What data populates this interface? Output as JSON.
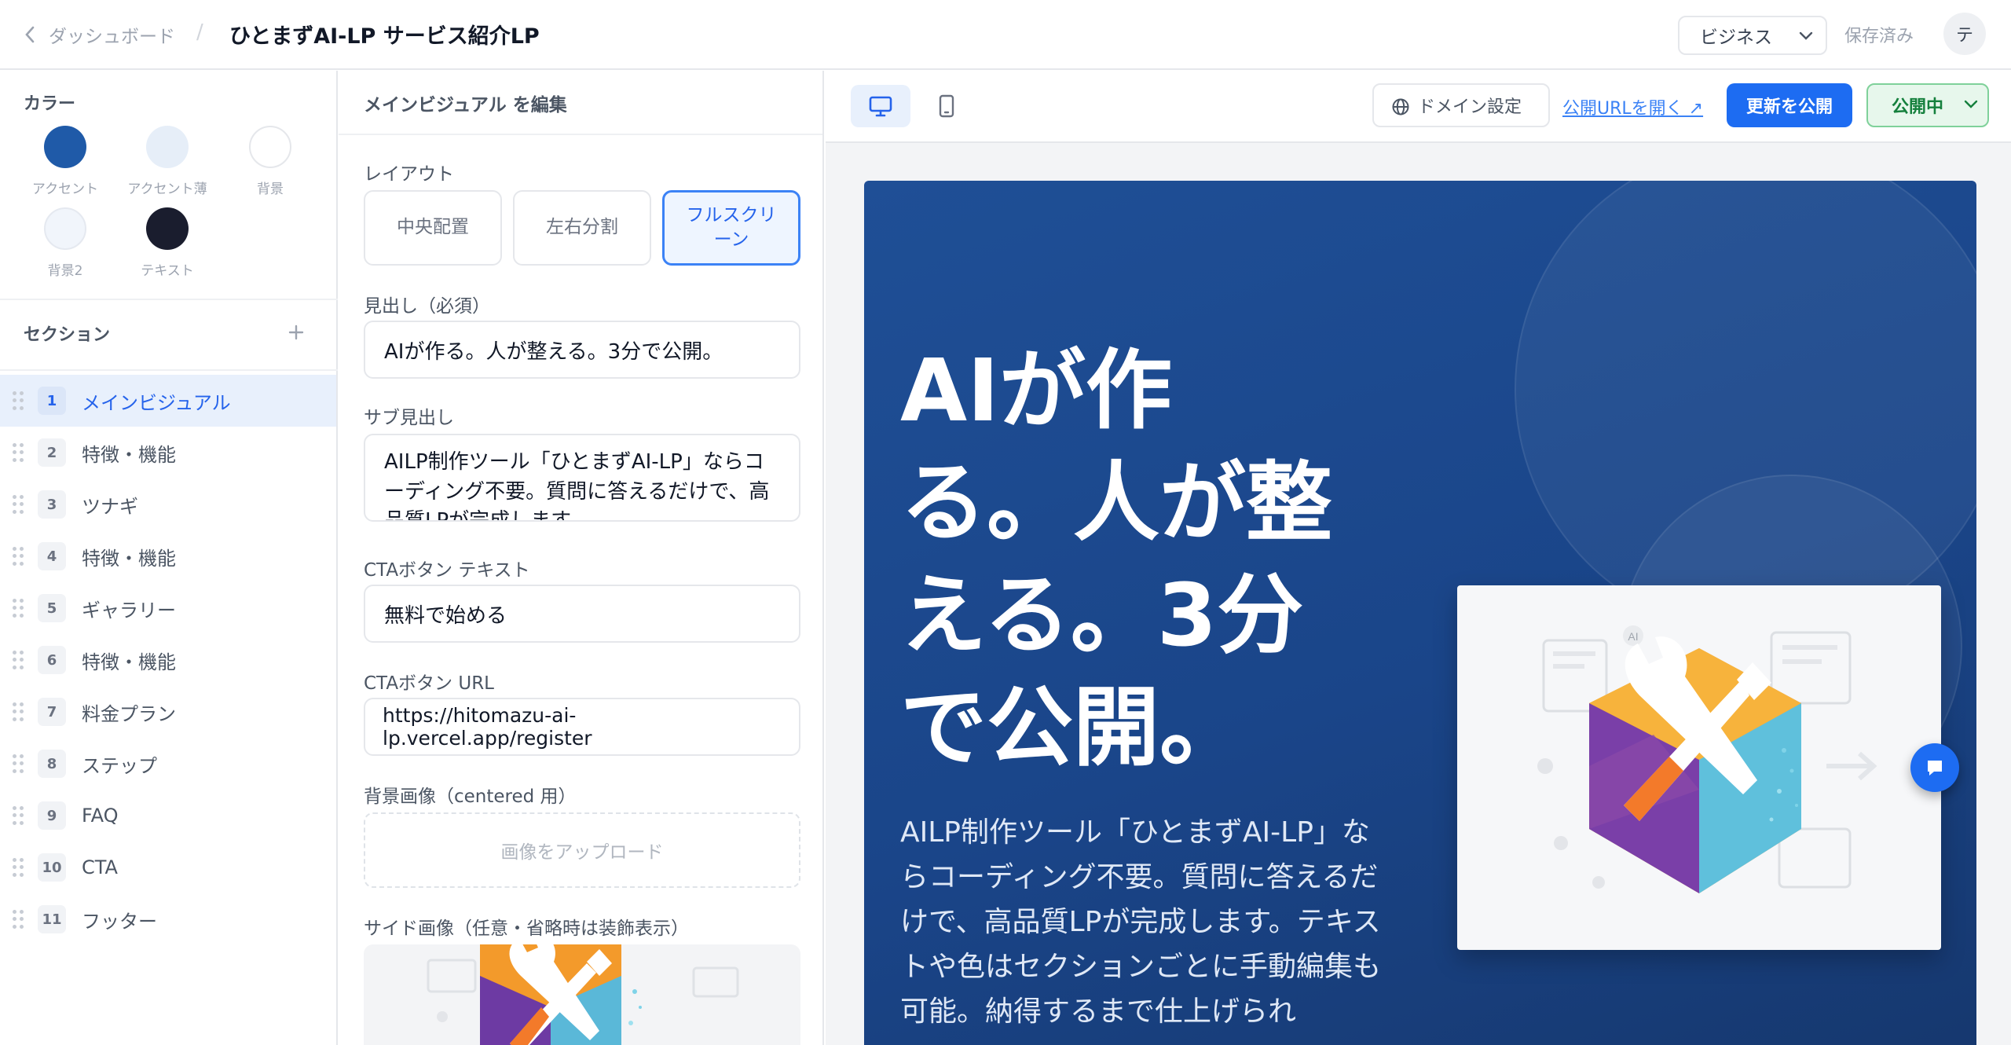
{
  "header": {
    "back_label": "ダッシュボード",
    "separator": "/",
    "title": "ひとまずAI-LP サービス紹介LP",
    "plan_value": "ビジネス",
    "save_status": "保存済み",
    "avatar_initial": "テ"
  },
  "sidebar": {
    "colors_heading": "カラー",
    "colors": [
      {
        "label": "アクセント",
        "hex": "#1f5aa8"
      },
      {
        "label": "アクセント薄",
        "hex": "#e6eef8"
      },
      {
        "label": "背景",
        "hex": "#ffffff"
      },
      {
        "label": "背景2",
        "hex": "#f1f5fb"
      },
      {
        "label": "テキスト",
        "hex": "#1a1d2e"
      }
    ],
    "sections_heading": "セクション",
    "add_icon": "plus-icon",
    "sections": [
      {
        "num": "1",
        "label": "メインビジュアル",
        "active": true
      },
      {
        "num": "2",
        "label": "特徴・機能"
      },
      {
        "num": "3",
        "label": "ツナギ"
      },
      {
        "num": "4",
        "label": "特徴・機能"
      },
      {
        "num": "5",
        "label": "ギャラリー"
      },
      {
        "num": "6",
        "label": "特徴・機能"
      },
      {
        "num": "7",
        "label": "料金プラン"
      },
      {
        "num": "8",
        "label": "ステップ"
      },
      {
        "num": "9",
        "label": "FAQ"
      },
      {
        "num": "10",
        "label": "CTA"
      },
      {
        "num": "11",
        "label": "フッター"
      }
    ]
  },
  "editor": {
    "title": "メインビジュアル を編集",
    "layout_label": "レイアウト",
    "layout_options": [
      "中央配置",
      "左右分割",
      "フルスクリーン"
    ],
    "layout_selected": "フルスクリーン",
    "headline_label": "見出し（必須）",
    "headline_value": "AIが作る。人が整える。3分で公開。",
    "subheadline_label": "サブ見出し",
    "subheadline_value": "AILP制作ツール「ひとまずAI-LP」ならコーディング不要。質問に答えるだけで、高品質LPが完成します。",
    "cta_text_label": "CTAボタン テキスト",
    "cta_text_value": "無料で始める",
    "cta_url_label": "CTAボタン URL",
    "cta_url_value": "https://hitomazu-ai-lp.vercel.app/register",
    "bg_image_label": "背景画像（centered 用）",
    "upload_label": "画像をアップロード",
    "side_image_label": "サイド画像（任意・省略時は装飾表示）"
  },
  "preview_toolbar": {
    "desktop_icon": "monitor-icon",
    "mobile_icon": "smartphone-icon",
    "domain_button": "ドメイン設定",
    "public_url_link": "公開URLを開く ↗",
    "publish_button": "更新を公開",
    "status_value": "公開中",
    "colors": {
      "primary": "#1d6cf2",
      "status_green": "#15803d"
    }
  },
  "preview": {
    "hero_heading": "AIが作る。人が整える。3分で公開。",
    "hero_subtext": "AILP制作ツール「ひとまずAI-LP」ならコーディング不要。質問に答えるだけで、高品質LPが完成します。テキストや色はセクションごとに手動編集も可能。納得するまで仕上げられ",
    "image_badge": "AI",
    "chat_icon": "chat-bubble-icon"
  }
}
